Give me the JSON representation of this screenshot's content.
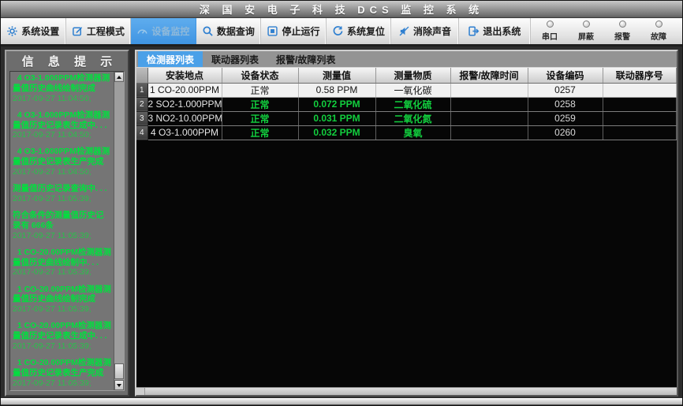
{
  "colors": {
    "accent_blue": "#2e7fd0",
    "active_tab_blue": "#4aa0e8",
    "status_green": "#12cf3e",
    "log_green": "#00e03e",
    "led_off": "#d6d6d6"
  },
  "title": "深 国 安 电 子 科 技 DCS 监 控 系 统",
  "toolbar": {
    "buttons": [
      {
        "label": "系统设置",
        "icon": "gear-icon",
        "active": false
      },
      {
        "label": "工程模式",
        "icon": "edit-icon",
        "active": false
      },
      {
        "label": "设备监控",
        "icon": "gauge-icon",
        "active": true
      },
      {
        "label": "数据查询",
        "icon": "search-icon",
        "active": false
      },
      {
        "label": "停止运行",
        "icon": "stop-icon",
        "active": false
      },
      {
        "label": "系统复位",
        "icon": "reset-icon",
        "active": false
      },
      {
        "label": "消除声音",
        "icon": "mute-icon",
        "active": false
      },
      {
        "label": "退出系统",
        "icon": "exit-icon",
        "active": false
      }
    ],
    "indicators": [
      {
        "label": "串口",
        "state": "off"
      },
      {
        "label": "屏蔽",
        "state": "off"
      },
      {
        "label": "报警",
        "state": "off"
      },
      {
        "label": "故障",
        "state": "off"
      }
    ]
  },
  "left_panel": {
    "title": "信 息 提 示",
    "messages": [
      {
        "text": "  4 O3-1.000PPM检测器测量值历史曲线绘制完成",
        "time": "2017-09-27 11:04:50;"
      },
      {
        "text": "  4 O3-1.000PPM检测器测量值历史记录表生成中. . .",
        "time": "2017-09-27 11:04:50;"
      },
      {
        "text": "  4 O3-1.000PPM检测器测量值历史记录表生产完成",
        "time": "2017-09-27 11:04:50;"
      },
      {
        "text": "测量值历史记录查询中. . .",
        "time": "2017-09-27 11:05:39;"
      },
      {
        "text": "符合条件的测量值历史记录有 666条",
        "time": "2017-09-27 11:05:39;"
      },
      {
        "text": "  1 CO-20.00PPM检测器测量值历史曲线绘制中. . .",
        "time": "2017-09-27 11:05:39;"
      },
      {
        "text": "  1 CO-20.00PPM检测器测量值历史曲线绘制完成",
        "time": "2017-09-27 11:05:39;"
      },
      {
        "text": "  1 CO-20.00PPM检测器测量值历史记录表生成中. . .",
        "time": "2017-09-27 11:05:39;"
      },
      {
        "text": "  1 CO-20.00PPM检测器测量值历史记录表生产完成",
        "time": "2017-09-27 11:05:39;"
      }
    ]
  },
  "main": {
    "tabs": [
      {
        "label": "检测器列表",
        "active": true
      },
      {
        "label": "联动器列表",
        "active": false
      },
      {
        "label": "报警/故障列表",
        "active": false
      }
    ],
    "table": {
      "headers": [
        "安装地点",
        "设备状态",
        "测量值",
        "测量物质",
        "报警/故障时间",
        "设备编码",
        "联动器序号"
      ],
      "rows": [
        {
          "num": "1",
          "location": "1 CO-20.00PPM",
          "status": "正常",
          "value": "0.58 PPM",
          "substance": "一氧化碳",
          "alarm_time": "",
          "code": "0257",
          "linkage": "",
          "selected": true
        },
        {
          "num": "2",
          "location": "2 SO2-1.000PPM",
          "status": "正常",
          "value": "0.072 PPM",
          "substance": "二氧化硫",
          "alarm_time": "",
          "code": "0258",
          "linkage": "",
          "selected": false
        },
        {
          "num": "3",
          "location": "3 NO2-10.00PPM",
          "status": "正常",
          "value": "0.031 PPM",
          "substance": "二氧化氮",
          "alarm_time": "",
          "code": "0259",
          "linkage": "",
          "selected": false
        },
        {
          "num": "4",
          "location": "4 O3-1.000PPM",
          "status": "正常",
          "value": "0.032 PPM",
          "substance": "臭氧",
          "alarm_time": "",
          "code": "0260",
          "linkage": "",
          "selected": false
        }
      ]
    }
  }
}
